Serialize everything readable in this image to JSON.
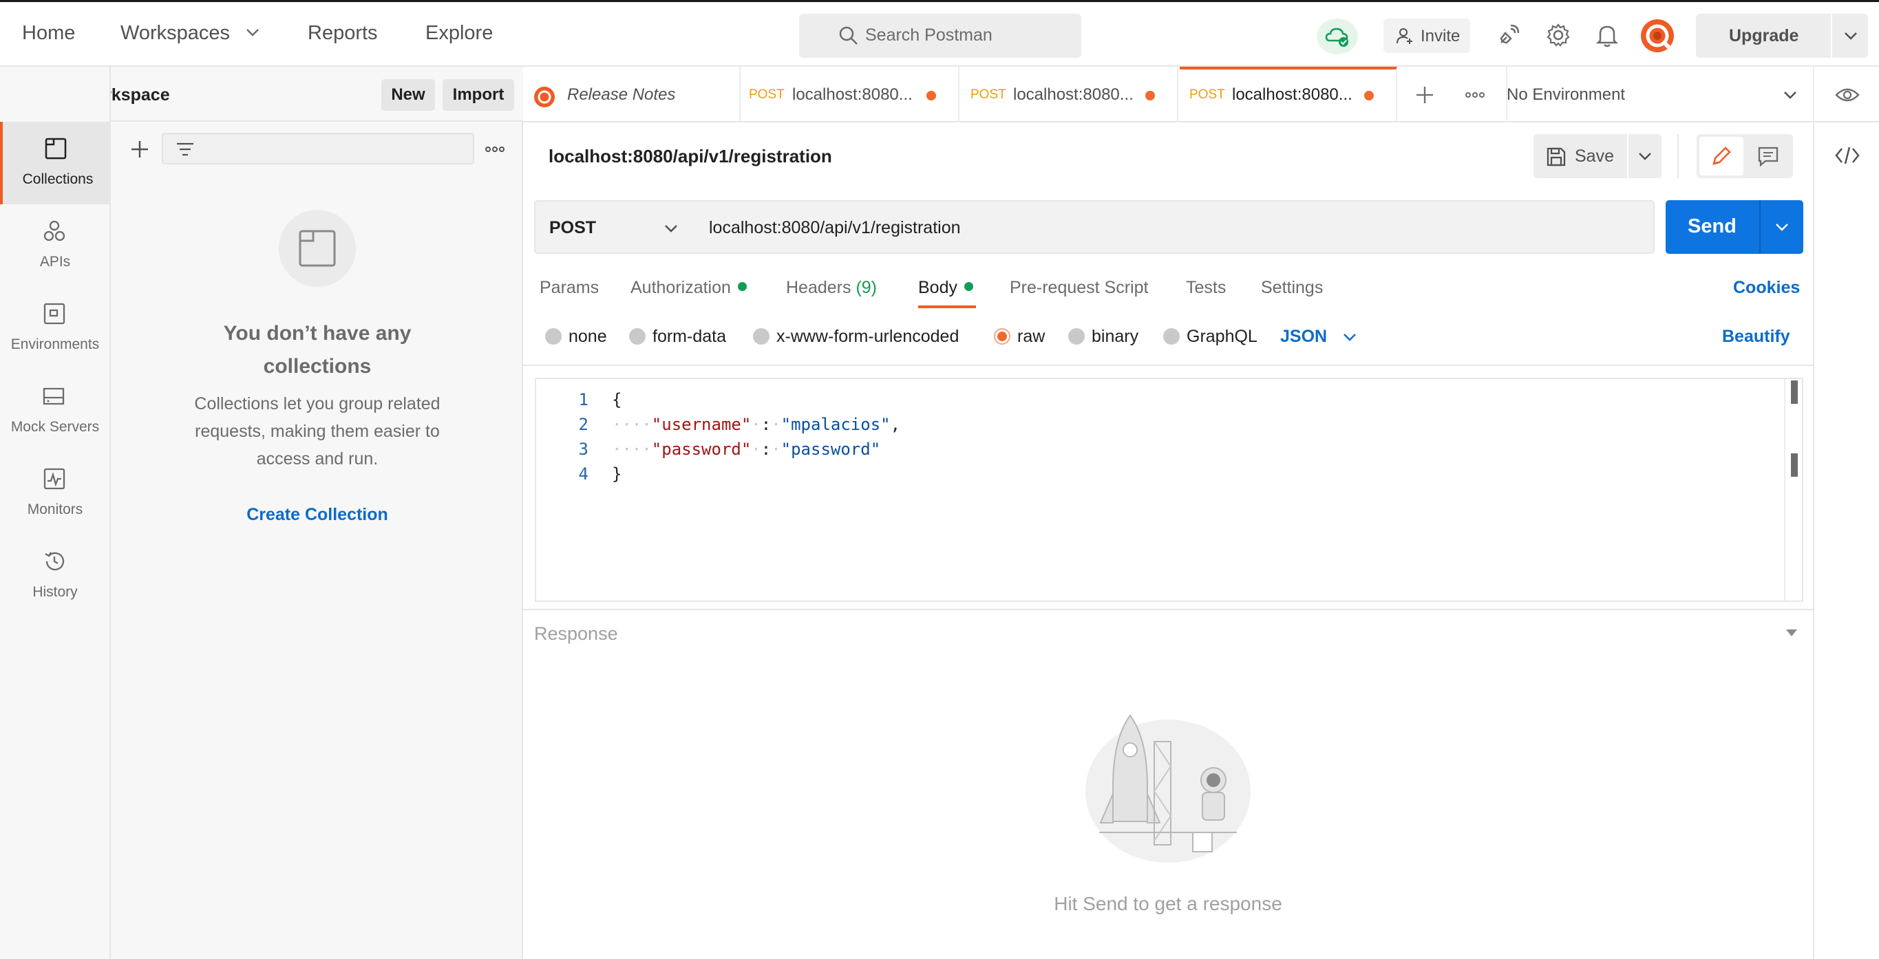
{
  "topbar": {
    "nav": [
      "Home",
      "Workspaces",
      "Reports",
      "Explore"
    ],
    "search_placeholder": "Search Postman",
    "invite_label": "Invite",
    "upgrade_label": "Upgrade"
  },
  "workspace": {
    "title": "My Workspace",
    "new_label": "New",
    "import_label": "Import"
  },
  "rail": [
    "Collections",
    "APIs",
    "Environments",
    "Mock Servers",
    "Monitors",
    "History"
  ],
  "sidebar": {
    "empty_title": "You don’t have any collections",
    "empty_desc": "Collections let you group related requests, making them easier to access and run.",
    "create_label": "Create Collection"
  },
  "tabs": [
    {
      "method": "",
      "name": "Release Notes"
    },
    {
      "method": "POST",
      "name": "localhost:8080..."
    },
    {
      "method": "POST",
      "name": "localhost:8080..."
    },
    {
      "method": "POST",
      "name": "localhost:8080..."
    }
  ],
  "environment": "No Environment",
  "request": {
    "title": "localhost:8080/api/v1/registration",
    "save_label": "Save",
    "method": "POST",
    "url": "localhost:8080/api/v1/registration",
    "send_label": "Send",
    "subtabs": [
      "Params",
      "Authorization",
      "Headers",
      "Body",
      "Pre-request Script",
      "Tests",
      "Settings"
    ],
    "headers_count": "(9)",
    "cookies_label": "Cookies",
    "body_types": [
      "none",
      "form-data",
      "x-www-form-urlencoded",
      "raw",
      "binary",
      "GraphQL"
    ],
    "body_format": "JSON",
    "beautify_label": "Beautify",
    "body_lines": {
      "l1": "{",
      "l2_key": "\"username\"",
      "l2_val": "\"mpalacios\"",
      "l3_key": "\"password\"",
      "l3_val": "\"password\"",
      "l4": "}"
    },
    "line_numbers": [
      "1",
      "2",
      "3",
      "4"
    ]
  },
  "response": {
    "title": "Response",
    "hint": "Hit Send to get a response"
  },
  "colors": {
    "accent": "#ef5b25",
    "send": "#0d74e0",
    "link": "#0b6bcb",
    "status_green": "#0f9d58"
  }
}
